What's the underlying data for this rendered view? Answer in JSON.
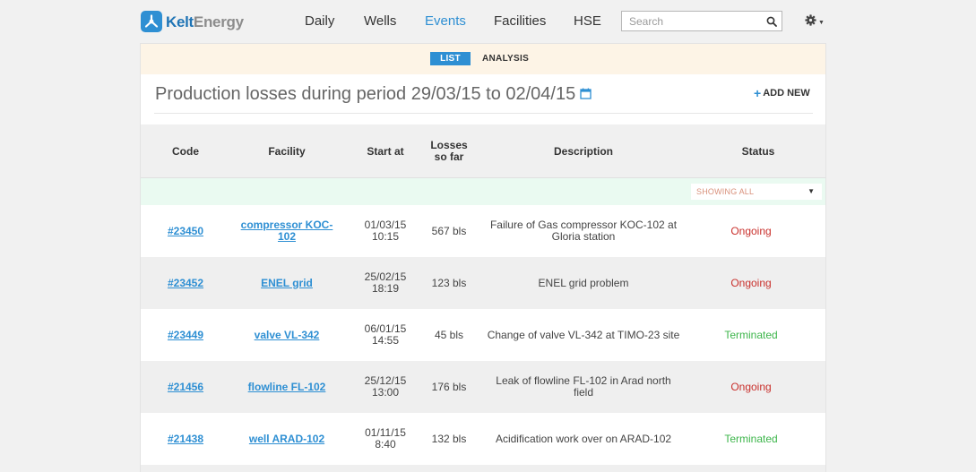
{
  "brand": {
    "name_part1": "Kelt",
    "name_part2": "Energy",
    "accent": "#2e8fd3"
  },
  "nav": {
    "items": [
      {
        "label": "Daily",
        "active": false
      },
      {
        "label": "Wells",
        "active": false
      },
      {
        "label": "Events",
        "active": true
      },
      {
        "label": "Facilities",
        "active": false
      },
      {
        "label": "HSE",
        "active": false
      }
    ],
    "search_placeholder": "Search",
    "settings_icon": "gear-icon"
  },
  "view_tabs": {
    "list": "LIST",
    "analysis": "ANALYSIS",
    "active": "list"
  },
  "panel": {
    "title": "Production losses during period 29/03/15 to 02/04/15",
    "add_new": "ADD NEW"
  },
  "table": {
    "columns": {
      "code": "Code",
      "facility": "Facility",
      "start": "Start at",
      "losses": "Losses so far",
      "description": "Description",
      "status": "Status"
    },
    "status_filter": "SHOWING ALL",
    "rows": [
      {
        "code": "#23450",
        "facility": "compressor KOC-102",
        "start_date": "01/03/15",
        "start_time": "10:15",
        "losses": "567 bls",
        "description": "Failure of Gas compressor KOC-102 at Gloria station",
        "status": "Ongoing"
      },
      {
        "code": "#23452",
        "facility": "ENEL grid",
        "start_date": "25/02/15",
        "start_time": "18:19",
        "losses": "123 bls",
        "description": "ENEL grid problem",
        "status": "Ongoing"
      },
      {
        "code": "#23449",
        "facility": "valve VL-342",
        "start_date": "06/01/15",
        "start_time": "14:55",
        "losses": "45 bls",
        "description": "Change of valve VL-342 at TIMO-23 site",
        "status": "Terminated"
      },
      {
        "code": "#21456",
        "facility": "flowline FL-102",
        "start_date": "25/12/15",
        "start_time": "13:00",
        "losses": "176 bls",
        "description": "Leak of flowline FL-102 in Arad north field",
        "status": "Ongoing"
      },
      {
        "code": "#21438",
        "facility": "well ARAD-102",
        "start_date": "01/11/15",
        "start_time": "8:40",
        "losses": "132 bls",
        "description": "Acidification work over on ARAD-102",
        "status": "Terminated"
      }
    ]
  },
  "colors": {
    "ongoing": "#c9302c",
    "terminated": "#3cb54a",
    "tab_bar": "#fdf4e6",
    "filter_row": "#eafaf1"
  }
}
